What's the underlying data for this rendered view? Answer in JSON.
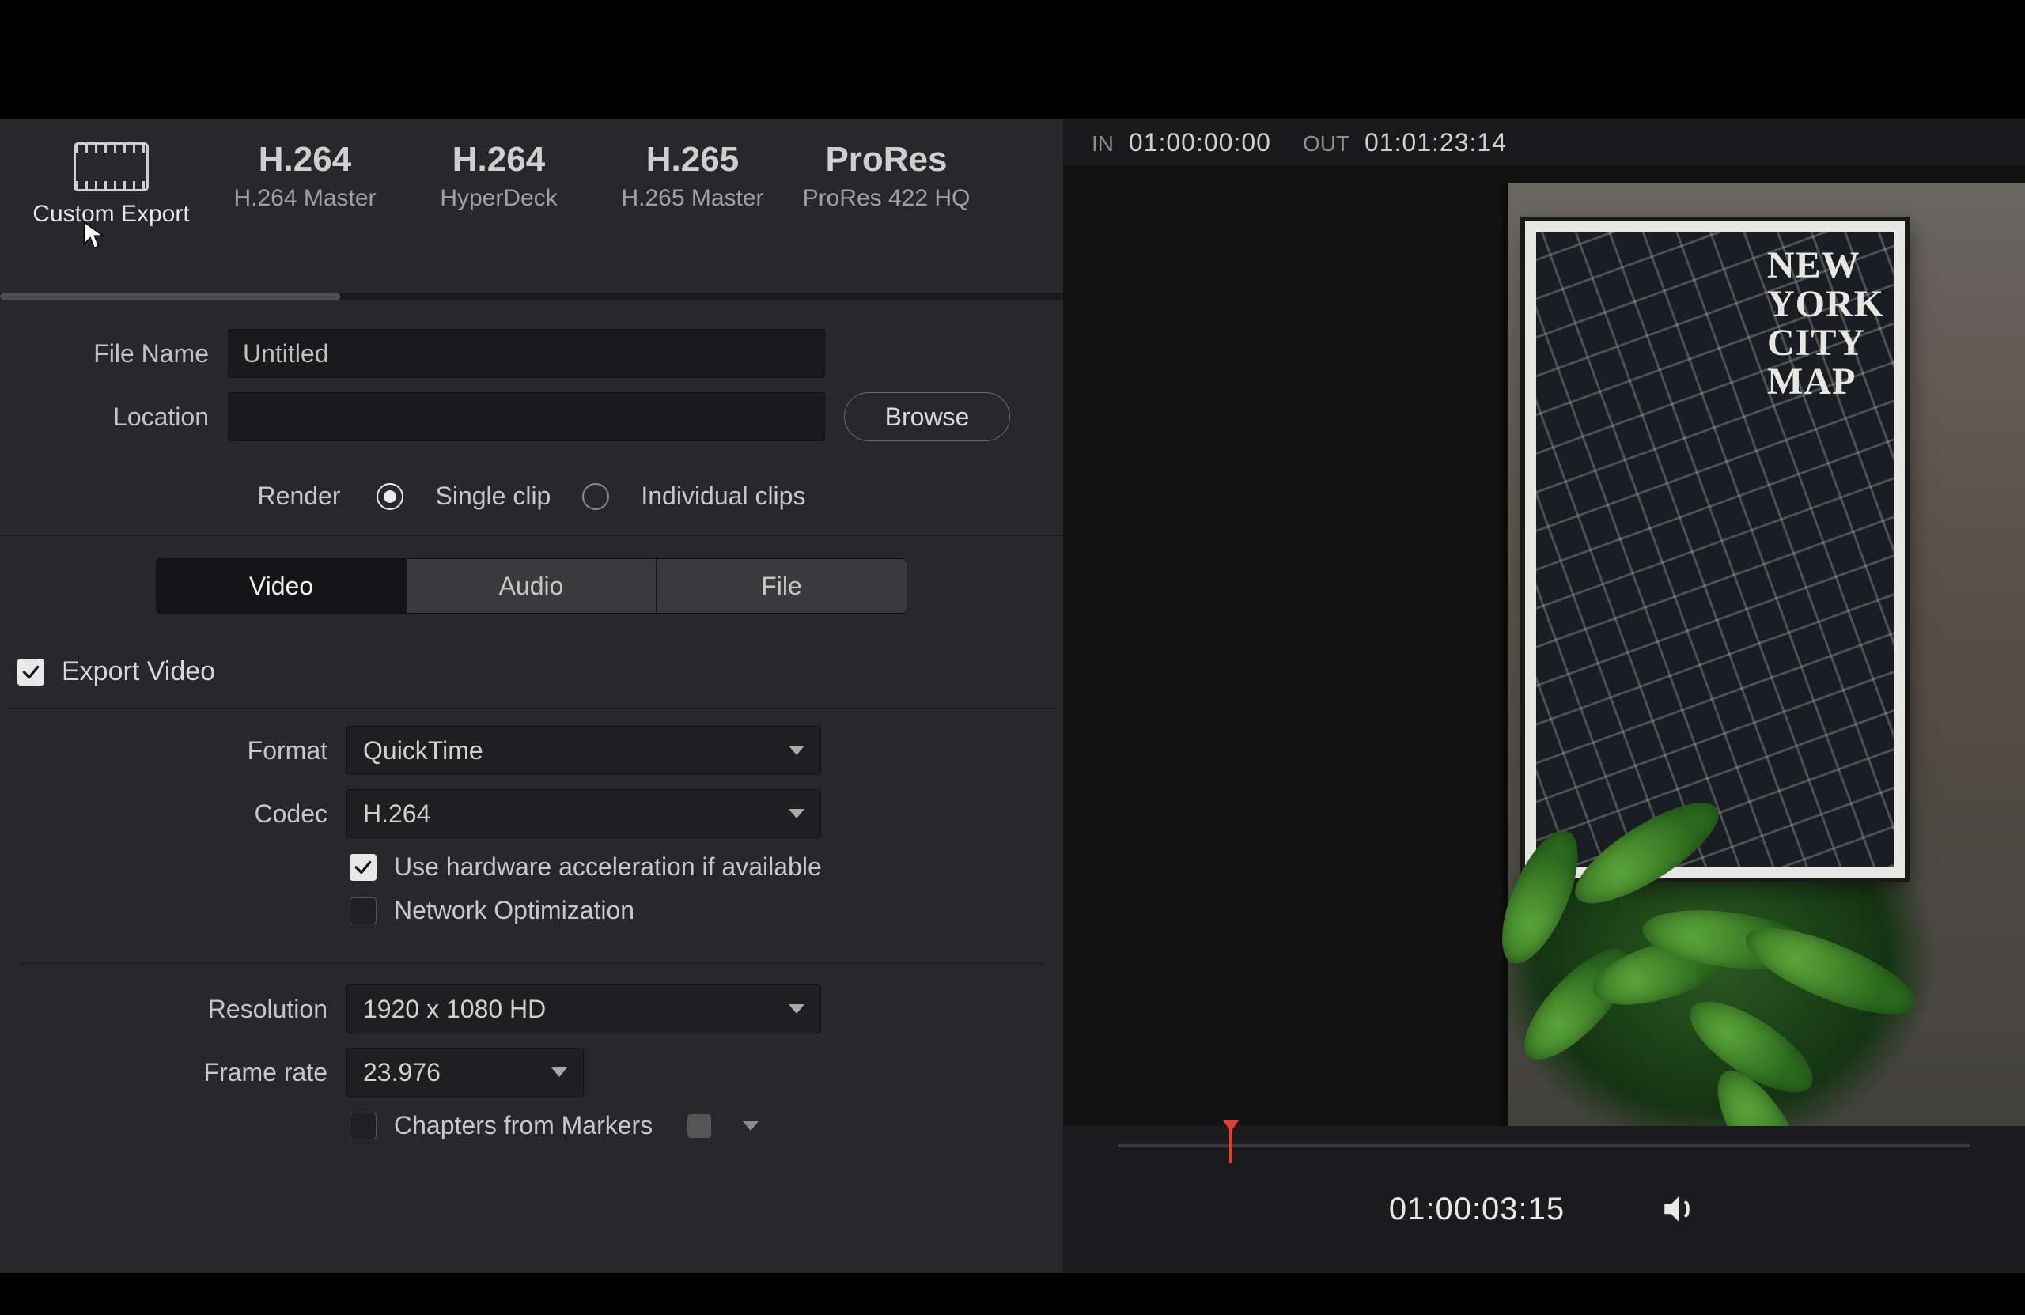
{
  "timebar": {
    "in_label": "IN",
    "in_tc": "01:00:00:00",
    "out_label": "OUT",
    "out_tc": "01:01:23:14"
  },
  "presets": [
    {
      "title": "",
      "subtitle": "Custom Export",
      "icon": true,
      "selected": true
    },
    {
      "title": "H.264",
      "subtitle": "H.264 Master"
    },
    {
      "title": "H.264",
      "subtitle": "HyperDeck"
    },
    {
      "title": "H.265",
      "subtitle": "H.265 Master"
    },
    {
      "title": "ProRes",
      "subtitle": "ProRes 422 HQ"
    }
  ],
  "fields": {
    "file_name_label": "File Name",
    "file_name_value": "Untitled",
    "location_label": "Location",
    "location_value": "",
    "browse_label": "Browse"
  },
  "render": {
    "label": "Render",
    "options": [
      {
        "label": "Single clip",
        "checked": true
      },
      {
        "label": "Individual clips",
        "checked": false
      }
    ]
  },
  "tabs": {
    "items": [
      "Video",
      "Audio",
      "File"
    ],
    "active": 0
  },
  "export_video": {
    "label": "Export Video",
    "checked": true
  },
  "video_settings": {
    "format_label": "Format",
    "format_value": "QuickTime",
    "codec_label": "Codec",
    "codec_value": "H.264",
    "hw_accel_label": "Use hardware acceleration if available",
    "hw_accel_checked": true,
    "network_opt_label": "Network Optimization",
    "network_opt_checked": false,
    "resolution_label": "Resolution",
    "resolution_value": "1920 x 1080 HD",
    "frame_rate_label": "Frame rate",
    "frame_rate_value": "23.976",
    "chapters_label": "Chapters from Markers",
    "chapters_checked": false
  },
  "transport": {
    "current_tc": "01:00:03:15"
  },
  "poster": {
    "line1": "NEW",
    "line2": "YORK",
    "line3": "CITY",
    "line4": "MAP"
  }
}
